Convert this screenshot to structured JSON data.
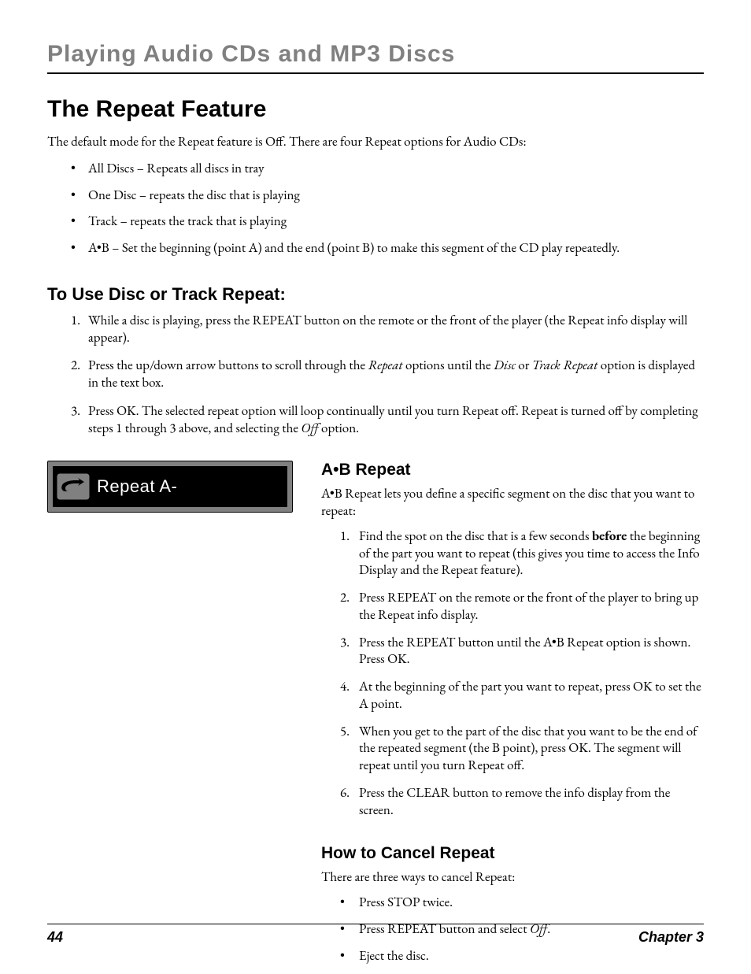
{
  "chapter_head": "Playing Audio CDs and MP3 Discs",
  "section": {
    "h1": "The Repeat Feature",
    "intro": "The default mode for the Repeat feature is Off. There are four Repeat options for Audio CDs:",
    "bullets": [
      "All Discs – Repeats all discs in tray",
      "One Disc – repeats the disc that is playing",
      "Track – repeats the track that is playing",
      "A•B – Set the beginning (point A) and the end (point B) to make this segment of the CD play repeatedly."
    ],
    "sub1": {
      "h2": "To Use Disc or Track Repeat:",
      "steps": [
        {
          "pre": "While a disc is playing, press the REPEAT button on the remote or the front of the player (the Repeat info display will appear)."
        },
        {
          "pre": "Press the up/down arrow buttons to scroll through the ",
          "i1": "Repeat",
          "mid": " options until the ",
          "i2": "Disc",
          "mid2": " or ",
          "i3": "Track Repeat",
          "post": " option is displayed in the text box."
        },
        {
          "pre": "Press OK. The selected repeat option will loop continually until you turn Repeat off. Repeat is turned off by completing steps 1 through 3 above, and selecting the ",
          "i1": "Off",
          "post": " option."
        }
      ]
    },
    "osd_label": "Repeat A-",
    "ab": {
      "h3": "A•B Repeat",
      "intro": "A•B Repeat lets you define a specific segment on the disc that you want to repeat:",
      "steps": [
        {
          "pre": "Find the spot on the disc that is a few seconds ",
          "b": "before",
          "post": " the beginning of the part you want to repeat (this gives you time to access the Info Display and the Repeat feature)."
        },
        {
          "pre": "Press REPEAT on the remote or the front of the player to bring up the Repeat info display."
        },
        {
          "pre": "Press the REPEAT button until the A•B Repeat option is shown. Press OK."
        },
        {
          "pre": "At the beginning of the part you want to repeat, press OK to set the A point."
        },
        {
          "pre": "When you get to the part of the disc that you want to be the end of the repeated segment (the B point), press OK. The segment will repeat until you turn Repeat off."
        },
        {
          "pre": "Press the CLEAR button to remove the info display from the screen."
        }
      ]
    },
    "cancel": {
      "h3": "How to Cancel Repeat",
      "intro": "There are three ways to cancel Repeat:",
      "bullets": [
        {
          "pre": "Press STOP twice."
        },
        {
          "pre": "Press REPEAT button and select ",
          "i": "Off",
          "post": "."
        },
        {
          "pre": "Eject the disc."
        }
      ]
    }
  },
  "footer": {
    "page": "44",
    "chapter": "Chapter 3"
  }
}
